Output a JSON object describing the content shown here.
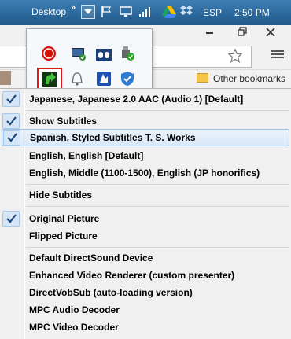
{
  "taskbar": {
    "desktop_label": "Desktop",
    "overflow_chevron": "»",
    "language": "ESP",
    "time": "2:50 PM"
  },
  "browser": {
    "other_bookmarks": "Other bookmarks"
  },
  "tray_icons": [
    "lastfm-icon",
    "monitor-check-icon",
    "dolby-icon",
    "usb-safe-remove-icon",
    "mpc-green-icon",
    "bell-icon",
    "blue-shield-icon",
    "security-check-icon"
  ],
  "menu": {
    "items": [
      {
        "label": "Japanese, Japanese 2.0 AAC (Audio 1) [Default]",
        "checked": true
      },
      {
        "label": "Show Subtitles",
        "checked": true
      },
      {
        "label": "Spanish, Styled Subtitles T. S. Works",
        "checked": true,
        "highlighted": true
      },
      {
        "label": "English, English [Default]",
        "checked": false
      },
      {
        "label": "English, Middle (1100-1500), English (JP honorifics)",
        "checked": false
      },
      {
        "label": "Hide Subtitles",
        "checked": false
      },
      {
        "label": "Original Picture",
        "checked": true
      },
      {
        "label": "Flipped Picture",
        "checked": false
      },
      {
        "label": "Default DirectSound Device",
        "checked": false
      },
      {
        "label": "Enhanced Video Renderer (custom presenter)",
        "checked": false
      },
      {
        "label": "DirectVobSub (auto-loading version)",
        "checked": false
      },
      {
        "label": "MPC Audio Decoder",
        "checked": false
      },
      {
        "label": "MPC Video Decoder",
        "checked": false
      }
    ]
  },
  "colors": {
    "taskbar": "#2a6699",
    "highlight": "#d9e8f8",
    "check_bg": "#d7e6f6",
    "selection_border": "#e01a1a"
  }
}
